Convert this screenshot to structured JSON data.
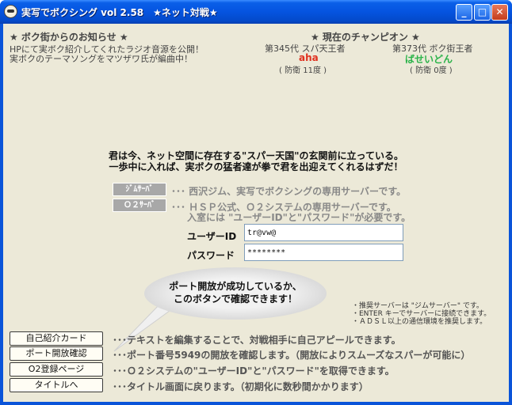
{
  "window": {
    "title": "実写でボクシング vol 2.58　★ネット対戦★",
    "min": "_",
    "max": "□",
    "close": "✕"
  },
  "news": {
    "heading": "★ ボク街からのお知らせ ★",
    "lines": [
      "HPにて実ボク紹介してくれたラジオ音源を公開！",
      "実ボクのテーマソングをマツザワ氏が編曲中！"
    ]
  },
  "champions": {
    "heading": "★ 現在のチャンピオン ★",
    "left": {
      "title": "第345代 スパ天王者",
      "name": "aha",
      "defense": "( 防衛 11度 )",
      "color": "#e0301e"
    },
    "right": {
      "title": "第373代 ボク街王者",
      "name": "ばせいどん",
      "defense": "( 防衛 0度 )",
      "color": "#2bb34a"
    }
  },
  "intro": {
    "line1": "君は今、ネット空間に存在する\"スパー天国\"の玄関前に立っている。",
    "line2": "一歩中に入れば、実ボクの猛者達が拳で君を出迎えてくれるはずだ！"
  },
  "servers": [
    {
      "button": "ｼﾞﾑｻｰﾊﾞ",
      "desc": "･･･ 西沢ジム、実写でボクシングの専用サーバーです。",
      "desc2": ""
    },
    {
      "button": "Ｏ２ｻｰﾊﾞ",
      "desc": "･･･ ＨＳＰ公式、Ｏ２システムの専用サーバーです。",
      "desc2": "入室には \"ユーザーID\"と\"パスワード\"が必要です。"
    }
  ],
  "login": {
    "user_label": "ユーザーID",
    "user_value": "tr@vw@",
    "pass_label": "パスワード",
    "pass_value": "********"
  },
  "bubble": {
    "line1": "ポート開放が成功しているか、",
    "line2": "このボタンで確認できます！"
  },
  "notes": [
    "・推奨サーバーは \"ジムサーバー\" です。",
    "・ENTER キーでサーバーに接続できます。",
    "・ＡＤＳＬ以上の通信環境を推奨します。"
  ],
  "menu": [
    {
      "label": "自己紹介カード",
      "desc": "･･･テキストを編集することで、対戦相手に自己アピールできます。"
    },
    {
      "label": "ポート開放確認",
      "desc": "･･･ポート番号5949の開放を確認します。（開放によりスムーズなスパーが可能に）"
    },
    {
      "label": "O2登録ページ",
      "desc": "･･･Ｏ２システムの\"ユーザーID\"と\"パスワード\"を取得できます。"
    },
    {
      "label": "タイトルへ",
      "desc": "･･･タイトル画面に戻ります。（初期化に数秒間かかります）"
    }
  ]
}
